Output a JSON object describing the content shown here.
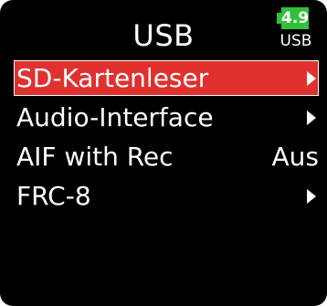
{
  "header": {
    "title": "USB"
  },
  "status": {
    "battery_icon": "battery-icon",
    "battery_value": "4.9",
    "power_source": "USB",
    "battery_color": "#2fc13a"
  },
  "menu": {
    "accent_color": "#e0312f",
    "items": [
      {
        "label": "SD-Kartenleser",
        "selected": true,
        "arrow_icon": "chevron-right-icon"
      },
      {
        "label": "Audio-Interface",
        "selected": false,
        "arrow_icon": "chevron-right-icon"
      },
      {
        "label": "AIF with Rec",
        "selected": false,
        "value": "Aus"
      },
      {
        "label": "FRC-8",
        "selected": false,
        "arrow_icon": "chevron-right-icon"
      }
    ]
  }
}
